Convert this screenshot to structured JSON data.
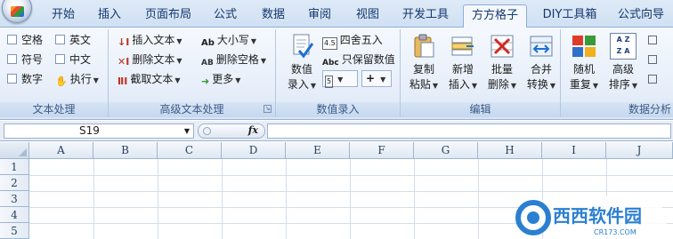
{
  "tabs": [
    "开始",
    "插入",
    "页面布局",
    "公式",
    "数据",
    "审阅",
    "视图",
    "开发工具",
    "方方格子",
    "DIY工具箱",
    "公式向导"
  ],
  "active_tab": "方方格子",
  "text_group": {
    "label": "文本处理",
    "checkboxes": [
      {
        "label": "空格"
      },
      {
        "label": "英文"
      },
      {
        "label": "符号"
      },
      {
        "label": "中文"
      },
      {
        "label": "数字"
      }
    ],
    "execute_label": "执行"
  },
  "adv_text_group": {
    "label": "高级文本处理",
    "insert_text": "插入文本",
    "delete_text": "删除文本",
    "cut_text": "截取文本",
    "case_label": "大小写",
    "delete_space": "删除空格",
    "more": "更多",
    "case_icon": "Ab",
    "space_icon": "AB"
  },
  "number_group": {
    "label": "数值录入",
    "input_label_1": "数值",
    "input_label_2": "录入",
    "round_label": "四舍五入",
    "keep_value": "只保留数值",
    "abc_icon": "Abc",
    "plus_label": "+",
    "round_icon": "4.5"
  },
  "edit_group": {
    "label": "编辑",
    "buttons": [
      {
        "l1": "复制",
        "l2": "粘贴"
      },
      {
        "l1": "新增",
        "l2": "插入"
      },
      {
        "l1": "批量",
        "l2": "删除"
      },
      {
        "l1": "合并",
        "l2": "转换"
      }
    ]
  },
  "analysis_group": {
    "label": "数据分析",
    "buttons": [
      {
        "l1": "随机",
        "l2": "重复"
      },
      {
        "l1": "高级",
        "l2": "排序"
      }
    ],
    "sort_icon_top": "A Z",
    "sort_icon_bottom": "Z A"
  },
  "formula_bar": {
    "cell_ref": "S19",
    "fx": "fx",
    "formula": ""
  },
  "sheet": {
    "columns": [
      "A",
      "B",
      "C",
      "D",
      "E",
      "F",
      "G",
      "H",
      "I",
      "J"
    ],
    "rows": [
      "1",
      "2",
      "3",
      "4",
      "5"
    ]
  },
  "watermark": {
    "brand": "西西软件园",
    "url": "CR173.COM"
  },
  "colors": {
    "tab_text": "#15386d",
    "ribbon_bg": "#e6eef9",
    "group_label": "#3b5a87",
    "watermark_blue": "#2b7fd1"
  }
}
